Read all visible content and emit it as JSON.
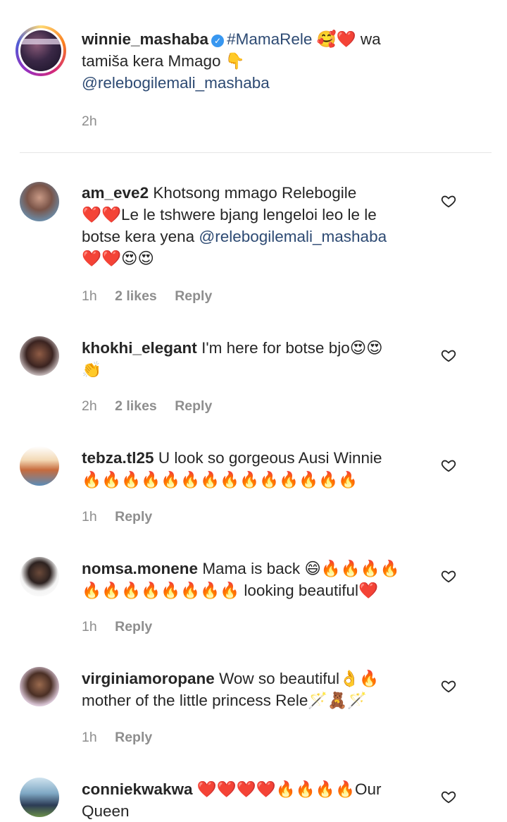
{
  "post": {
    "username": "winnie_mashaba",
    "line1": " #MamaRele 🥰❤️ wa",
    "line2": "tamiša kera Mmago 👇",
    "line3": "@relebogilemali_mashaba",
    "time": "2h"
  },
  "comments": [
    {
      "username": "am_eve2",
      "lines": [
        "Khotsong mmago Relebogile",
        "❤️❤️Le le tshwere bjang lengeloi leo le le",
        "botse kera yena ",
        "❤️❤️😍😍"
      ],
      "mention": "@relebogilemali_mashaba",
      "time": "1h",
      "likes": "2 likes",
      "reply": "Reply"
    },
    {
      "username": "khokhi_elegant",
      "lines": [
        "I'm here for botse bjo😍😍",
        "👏"
      ],
      "time": "2h",
      "likes": "2 likes",
      "reply": "Reply"
    },
    {
      "username": "tebza.tl25",
      "lines": [
        "U look so gorgeous Ausi Winnie",
        "🔥🔥🔥🔥🔥🔥🔥🔥🔥🔥🔥🔥🔥🔥"
      ],
      "time": "1h",
      "reply": "Reply"
    },
    {
      "username": "nomsa.monene",
      "lines": [
        "Mama is back 😄🔥🔥🔥🔥",
        "🔥🔥🔥🔥🔥🔥🔥🔥 looking beautiful❤️"
      ],
      "time": "1h",
      "reply": "Reply"
    },
    {
      "username": "virginiamoropane",
      "lines": [
        "Wow so beautiful👌🔥",
        "mother of the little princess Rele🪄🧸🪄"
      ],
      "time": "1h",
      "reply": "Reply"
    },
    {
      "username": "conniekwakwa",
      "lines": [
        "❤️❤️❤️❤️🔥🔥🔥🔥Our",
        "Queen"
      ]
    }
  ],
  "icons": {
    "like": "heart-outline-icon",
    "verified": "verified-badge-icon"
  },
  "colors": {
    "link": "#2d4a73",
    "meta": "#8e8e8e",
    "verified": "#3897f0"
  }
}
